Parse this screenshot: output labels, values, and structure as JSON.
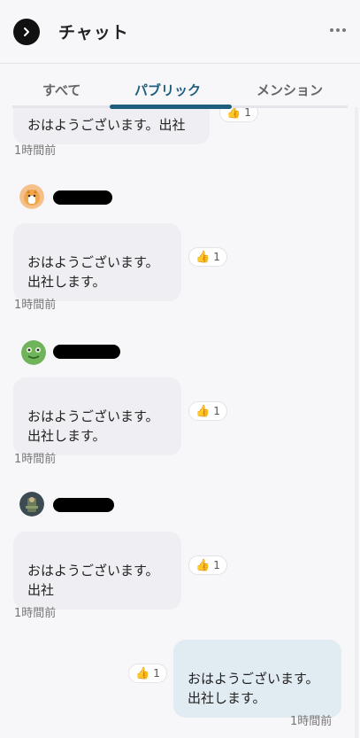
{
  "header": {
    "title": "チャット"
  },
  "tabs": [
    {
      "label": "すべて"
    },
    {
      "label": "パブリック"
    },
    {
      "label": "メンション"
    }
  ],
  "messages": [
    {
      "text": "おはようございます。出社",
      "time": "1時間前",
      "reaction_count": "1"
    },
    {
      "text": "おはようございます。\n出社します。",
      "time": "1時間前",
      "reaction_count": "1"
    },
    {
      "text": "おはようございます。\n出社します。",
      "time": "1時間前",
      "reaction_count": "1"
    },
    {
      "text": "おはようございます。\n出社",
      "time": "1時間前",
      "reaction_count": "1"
    },
    {
      "text": "おはようございます。\n出社します。",
      "time": "1時間前",
      "reaction_count": "1"
    }
  ],
  "colors": {
    "accent": "#1e5f7e",
    "bubble_other": "#efeef2",
    "bubble_me": "#e1ebf2"
  },
  "icons": {
    "back": "chevron-right-icon",
    "more": "more-horizontal-icon",
    "reaction": "thumbs-up-icon"
  }
}
